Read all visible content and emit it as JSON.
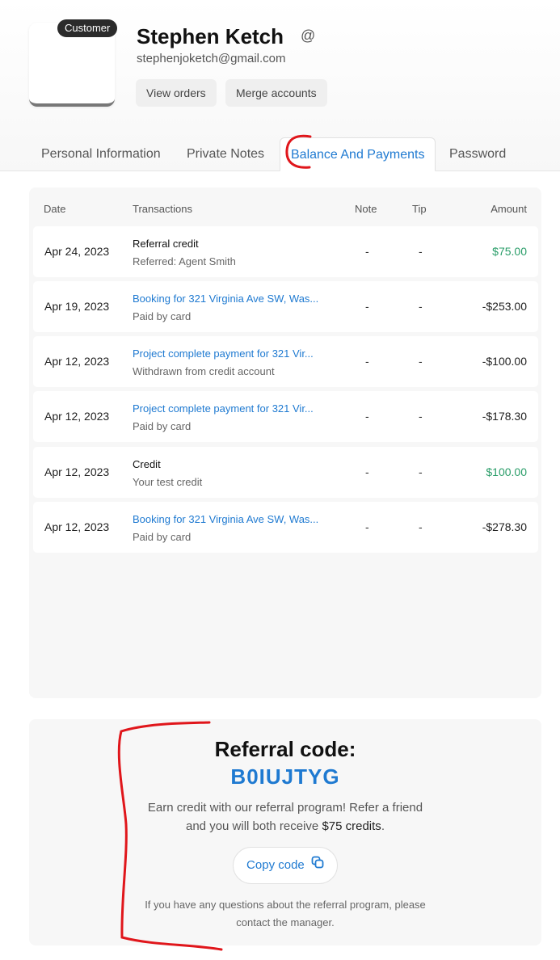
{
  "profile": {
    "badge": "Customer",
    "name": "Stephen Ketch",
    "email": "stephenjoketch@gmail.com",
    "at_icon": "@",
    "buttons": {
      "view_orders": "View orders",
      "merge_accounts": "Merge accounts"
    }
  },
  "tabs": [
    {
      "label": "Personal Information"
    },
    {
      "label": "Private Notes"
    },
    {
      "label": "Balance And Payments",
      "active": true
    },
    {
      "label": "Password"
    }
  ],
  "table": {
    "headers": {
      "date": "Date",
      "transactions": "Transactions",
      "note": "Note",
      "tip": "Tip",
      "amount": "Amount"
    },
    "rows": [
      {
        "date": "Apr 24, 2023",
        "title": "Referral credit",
        "subtitle": "Referred: Agent Smith",
        "note": "-",
        "tip": "-",
        "amount": "$75.00",
        "link": false,
        "positive": true
      },
      {
        "date": "Apr 19, 2023",
        "title": "Booking for 321 Virginia Ave SW, Was...",
        "subtitle": "Paid by card",
        "note": "-",
        "tip": "-",
        "amount": "-$253.00",
        "link": true,
        "positive": false
      },
      {
        "date": "Apr 12, 2023",
        "title": "Project complete payment for 321 Vir...",
        "subtitle": "Withdrawn from credit account",
        "note": "-",
        "tip": "-",
        "amount": "-$100.00",
        "link": true,
        "positive": false
      },
      {
        "date": "Apr 12, 2023",
        "title": "Project complete payment for 321 Vir...",
        "subtitle": "Paid by card",
        "note": "-",
        "tip": "-",
        "amount": "-$178.30",
        "link": true,
        "positive": false
      },
      {
        "date": "Apr 12, 2023",
        "title": "Credit",
        "subtitle": "Your test credit",
        "note": "-",
        "tip": "-",
        "amount": "$100.00",
        "link": false,
        "positive": true
      },
      {
        "date": "Apr 12, 2023",
        "title": "Booking for 321 Virginia Ave SW, Was...",
        "subtitle": "Paid by card",
        "note": "-",
        "tip": "-",
        "amount": "-$278.30",
        "link": true,
        "positive": false
      }
    ]
  },
  "referral": {
    "title": "Referral code:",
    "code": "B0IUJTYG",
    "desc_before": "Earn credit with our referral program! Refer a friend and you will both receive ",
    "desc_amount": "$75 credits",
    "desc_after": ".",
    "copy_label": "Copy code",
    "copy_icon": "copy-icon",
    "footer": "If you have any questions about the referral program, please contact the manager."
  },
  "colors": {
    "accent": "#1f7ad1",
    "positive": "#2a9d69",
    "annotation": "#e0161b"
  }
}
